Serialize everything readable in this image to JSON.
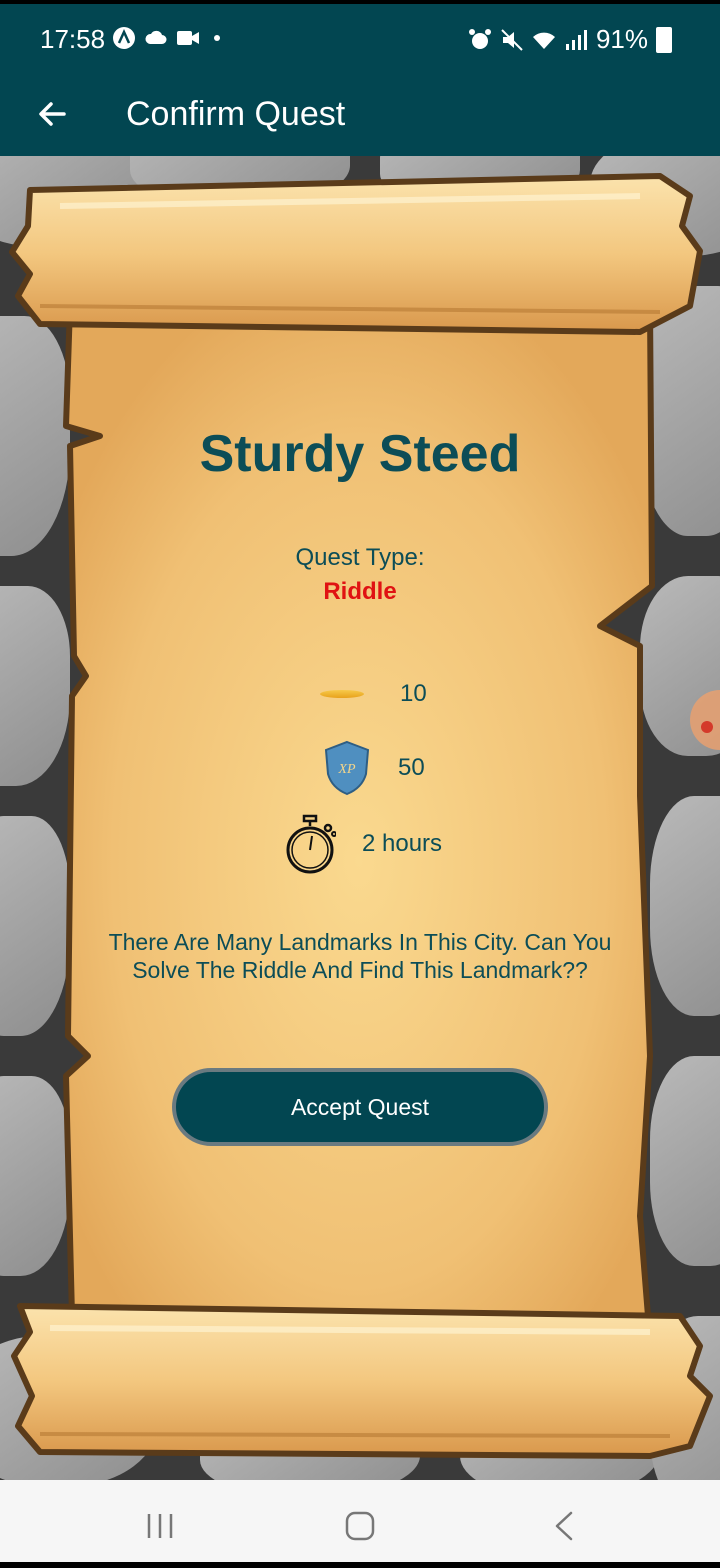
{
  "status_bar": {
    "time": "17:58",
    "battery": "91%"
  },
  "app_bar": {
    "title": "Confirm Quest"
  },
  "quest": {
    "title": "Sturdy Steed",
    "type_label": "Quest Type:",
    "type_value": "Riddle",
    "coins": "10",
    "xp": "50",
    "xp_badge": "XP",
    "duration": "2 hours",
    "description": "There Are Many Landmarks In This City. Can You Solve The Riddle And Find This Landmark??",
    "accept_label": "Accept Quest"
  },
  "colors": {
    "primary": "#024651",
    "title_text": "#0c4d57",
    "quest_type": "#e01212",
    "parchment": "#f2c57a"
  },
  "icons": [
    "back-arrow-icon",
    "coin-icon",
    "xp-shield-icon",
    "stopwatch-icon",
    "recent-apps-icon",
    "home-icon",
    "nav-back-icon"
  ]
}
